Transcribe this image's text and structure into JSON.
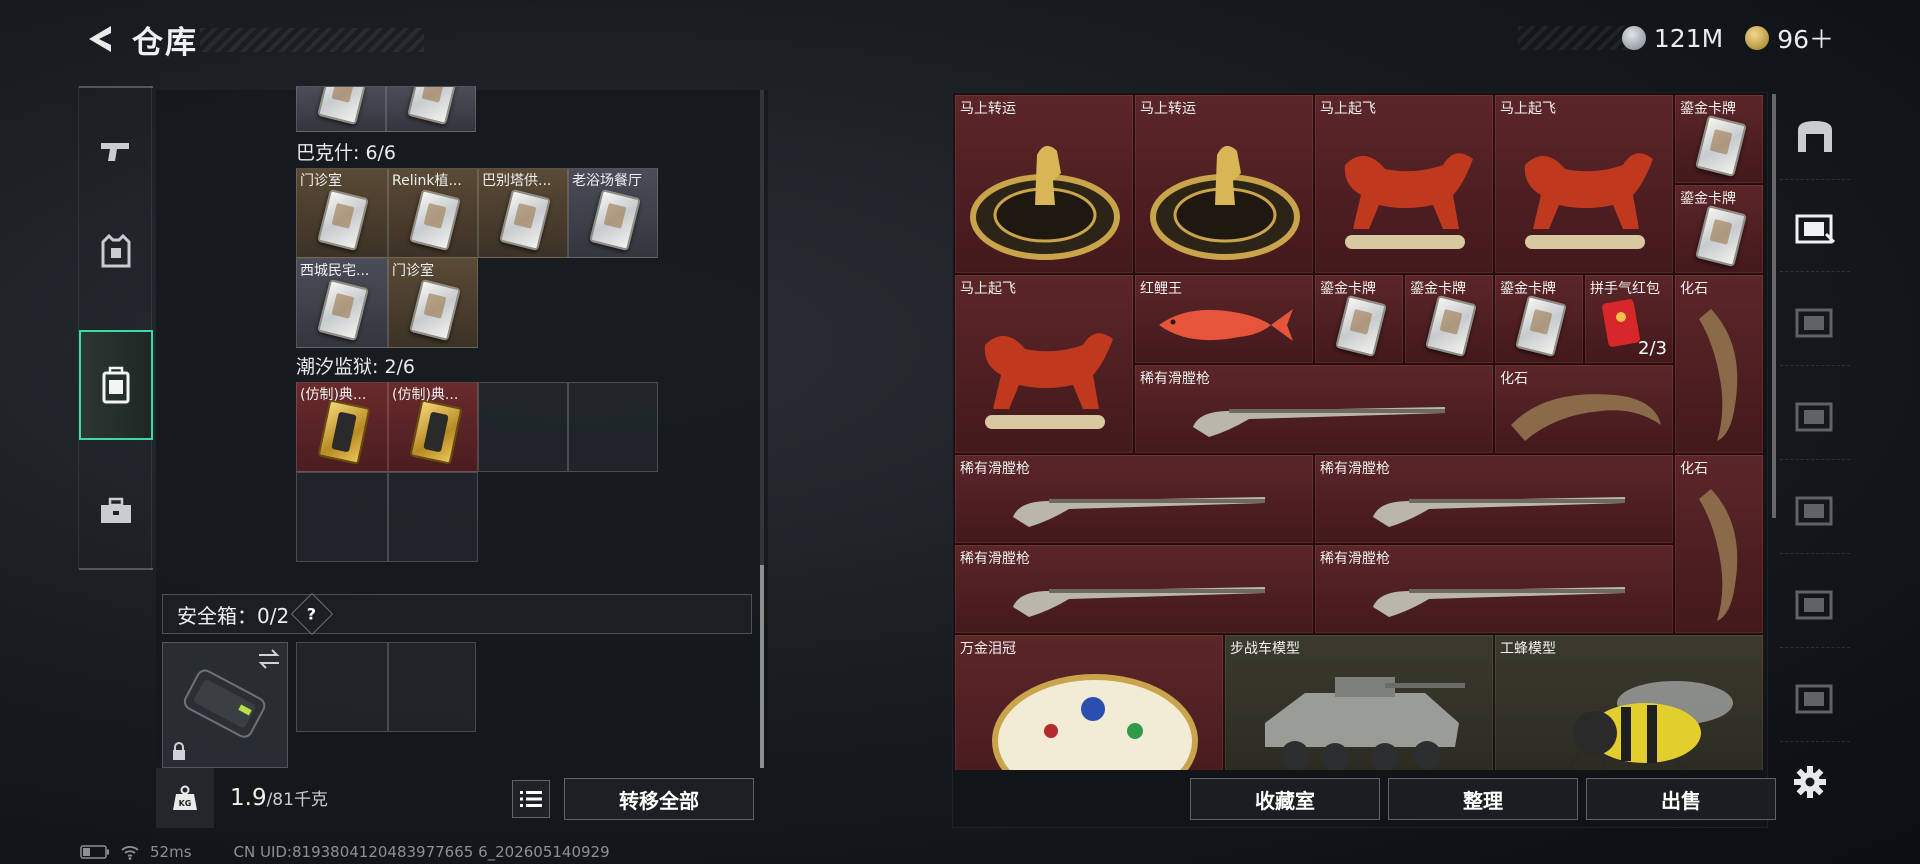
{
  "header": {
    "title": "仓库",
    "currencies": [
      {
        "icon": "silver-coin-icon",
        "value": "121M"
      },
      {
        "icon": "gold-coin-icon",
        "value": "96＋"
      }
    ]
  },
  "backpack": {
    "groups": [
      {
        "label": "巴克什: 6/6",
        "items": [
          "门诊室",
          "Relink植...",
          "巴别塔供...",
          "老浴场餐厅",
          "西城民宅...",
          "门诊室"
        ]
      },
      {
        "label": "潮汐监狱: 2/6",
        "items": [
          "(仿制)典...",
          "(仿制)典..."
        ]
      }
    ]
  },
  "safebox": {
    "label": "安全箱：0/2",
    "help": "?"
  },
  "weight": {
    "current": "1.9",
    "max_unit": "/81千克"
  },
  "buttons": {
    "transfer_all": "转移全部",
    "collection": "收藏室",
    "organize": "整理",
    "sell": "出售"
  },
  "status": {
    "ping": "52ms",
    "uid": "CN UID:8193804120483977665 6_202605140929"
  },
  "warehouse": {
    "items": [
      {
        "name": "马上转运"
      },
      {
        "name": "马上转运"
      },
      {
        "name": "马上起飞"
      },
      {
        "name": "马上起飞"
      },
      {
        "name": "鎏金卡牌"
      },
      {
        "name": "鎏金卡牌"
      },
      {
        "name": "马上起飞"
      },
      {
        "name": "红鲤王"
      },
      {
        "name": "鎏金卡牌"
      },
      {
        "name": "鎏金卡牌"
      },
      {
        "name": "鎏金卡牌"
      },
      {
        "name": "拼手气红包",
        "count": "2/3"
      },
      {
        "name": "化石"
      },
      {
        "name": "稀有滑膛枪"
      },
      {
        "name": "化石"
      },
      {
        "name": "稀有滑膛枪"
      },
      {
        "name": "稀有滑膛枪"
      },
      {
        "name": "化石"
      },
      {
        "name": "稀有滑膛枪"
      },
      {
        "name": "稀有滑膛枪"
      },
      {
        "name": "万金泪冠"
      },
      {
        "name": "步战车模型"
      },
      {
        "name": "工蜂模型"
      }
    ]
  }
}
